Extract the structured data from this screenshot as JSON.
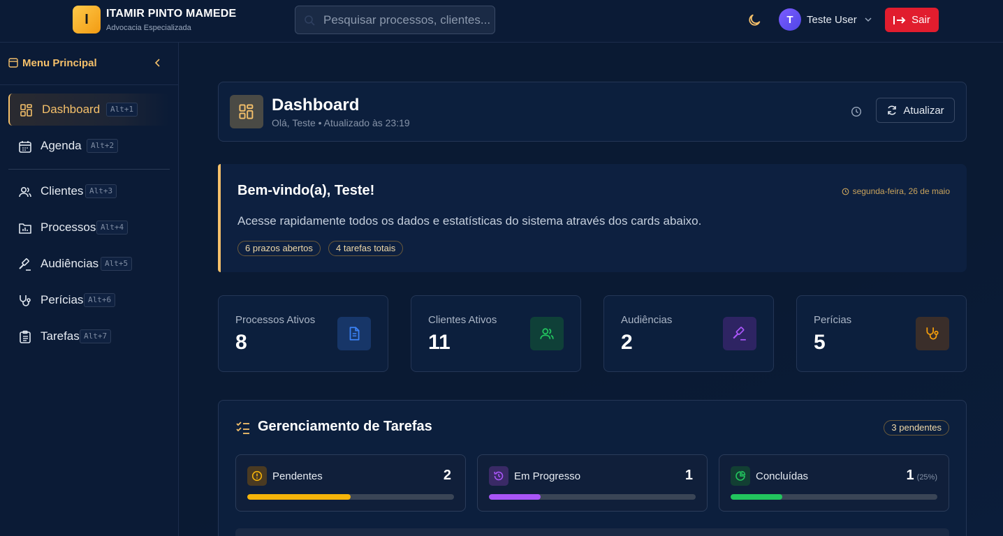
{
  "header": {
    "logo_letter": "I",
    "brand_title": "ITAMIR PINTO MAMEDE",
    "brand_subtitle": "Advocacia Especializada",
    "search_placeholder": "Pesquisar processos, clientes...",
    "user_initial": "T",
    "user_name": "Teste User",
    "logout_label": "Sair"
  },
  "sidebar": {
    "title": "Menu Principal",
    "items": [
      {
        "label": "Dashboard",
        "shortcut": "Alt+1",
        "icon": "dashboard-icon"
      },
      {
        "label": "Agenda",
        "shortcut": "Alt+2",
        "icon": "calendar-icon"
      },
      {
        "label": "Clientes",
        "shortcut": "Alt+3",
        "icon": "users-icon"
      },
      {
        "label": "Processos",
        "shortcut": "Alt+4",
        "icon": "folder-chart-icon"
      },
      {
        "label": "Audiências",
        "shortcut": "Alt+5",
        "icon": "gavel-icon"
      },
      {
        "label": "Perícias",
        "shortcut": "Alt+6",
        "icon": "stethoscope-icon"
      },
      {
        "label": "Tarefas",
        "shortcut": "Alt+7",
        "icon": "clipboard-icon"
      }
    ]
  },
  "dashboard": {
    "title": "Dashboard",
    "subtitle": "Olá, Teste • Atualizado às 23:19",
    "refresh_label": "Atualizar"
  },
  "welcome": {
    "title": "Bem-vindo(a), Teste!",
    "date": "segunda-feira, 26 de maio",
    "text": "Acesse rapidamente todos os dados e estatísticas do sistema através dos cards abaixo.",
    "pills": [
      "6 prazos abertos",
      "4 tarefas totais"
    ]
  },
  "stats": [
    {
      "label": "Processos Ativos",
      "value": "8",
      "icon": "document-icon",
      "color": "#3b82f6"
    },
    {
      "label": "Clientes Ativos",
      "value": "11",
      "icon": "users-icon",
      "color": "#22c55e"
    },
    {
      "label": "Audiências",
      "value": "2",
      "icon": "gavel-icon",
      "color": "#a855f7"
    },
    {
      "label": "Perícias",
      "value": "5",
      "icon": "stethoscope-icon",
      "color": "#f59e0b"
    }
  ],
  "tasks": {
    "title": "Gerenciamento de Tarefas",
    "badge": "3 pendentes",
    "cards": [
      {
        "label": "Pendentes",
        "count": "2",
        "pct": "",
        "progress": 0.5,
        "color": "#f5b40a"
      },
      {
        "label": "Em Progresso",
        "count": "1",
        "pct": "",
        "progress": 0.25,
        "color": "#a855f7"
      },
      {
        "label": "Concluídas",
        "count": "1",
        "pct": "(25%)",
        "progress": 0.25,
        "color": "#22c55e"
      }
    ]
  }
}
